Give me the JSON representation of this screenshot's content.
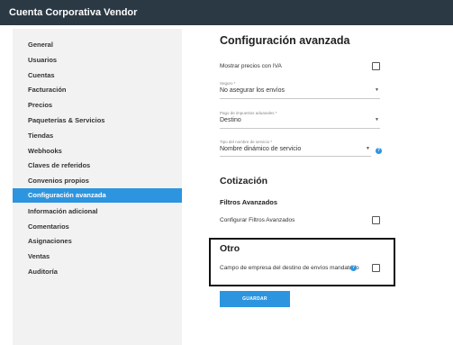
{
  "app": {
    "title": "Cuenta Corporativa Vendor"
  },
  "sidebar": {
    "items": [
      {
        "label": "General"
      },
      {
        "label": "Usuarios"
      },
      {
        "label": "Cuentas"
      },
      {
        "label": "Facturación"
      },
      {
        "label": "Precios"
      },
      {
        "label": "Paqueterías & Servicios"
      },
      {
        "label": "Tiendas"
      },
      {
        "label": "Webhooks"
      },
      {
        "label": "Claves de referidos"
      },
      {
        "label": "Convenios propios"
      },
      {
        "label": "Configuración avanzada",
        "active": true
      },
      {
        "label": "Información adicional"
      },
      {
        "label": "Comentarios"
      },
      {
        "label": "Asignaciones"
      },
      {
        "label": "Ventas"
      },
      {
        "label": "Auditoría"
      }
    ]
  },
  "main": {
    "title": "Configuración avanzada",
    "show_iva": {
      "label": "Mostrar precios con IVA",
      "checked": false
    },
    "seguro": {
      "label": "Seguro *",
      "value": "No asegurar los envíos"
    },
    "impuestos": {
      "label": "Pago de impuestos aduanales *",
      "value": "Destino"
    },
    "tipo_nombre": {
      "label": "Tipo del nombre de servicio *",
      "value": "Nombre dinámico de servicio"
    },
    "cotizacion": {
      "title": "Cotización",
      "filtros_title": "Filtros Avanzados",
      "filtros_label": "Configurar Filtros Avanzados",
      "checked": false
    },
    "otro": {
      "title": "Otro",
      "label": "Campo de empresa del destino de envíos mandatorio",
      "checked": false
    },
    "save_label": "GUARDAR"
  },
  "icons": {
    "help": "help-circle-icon",
    "caret": "caret-down-icon"
  },
  "colors": {
    "topbar": "#2b3944",
    "accent": "#2d95df",
    "sidebar_bg": "#f2f2f2"
  }
}
